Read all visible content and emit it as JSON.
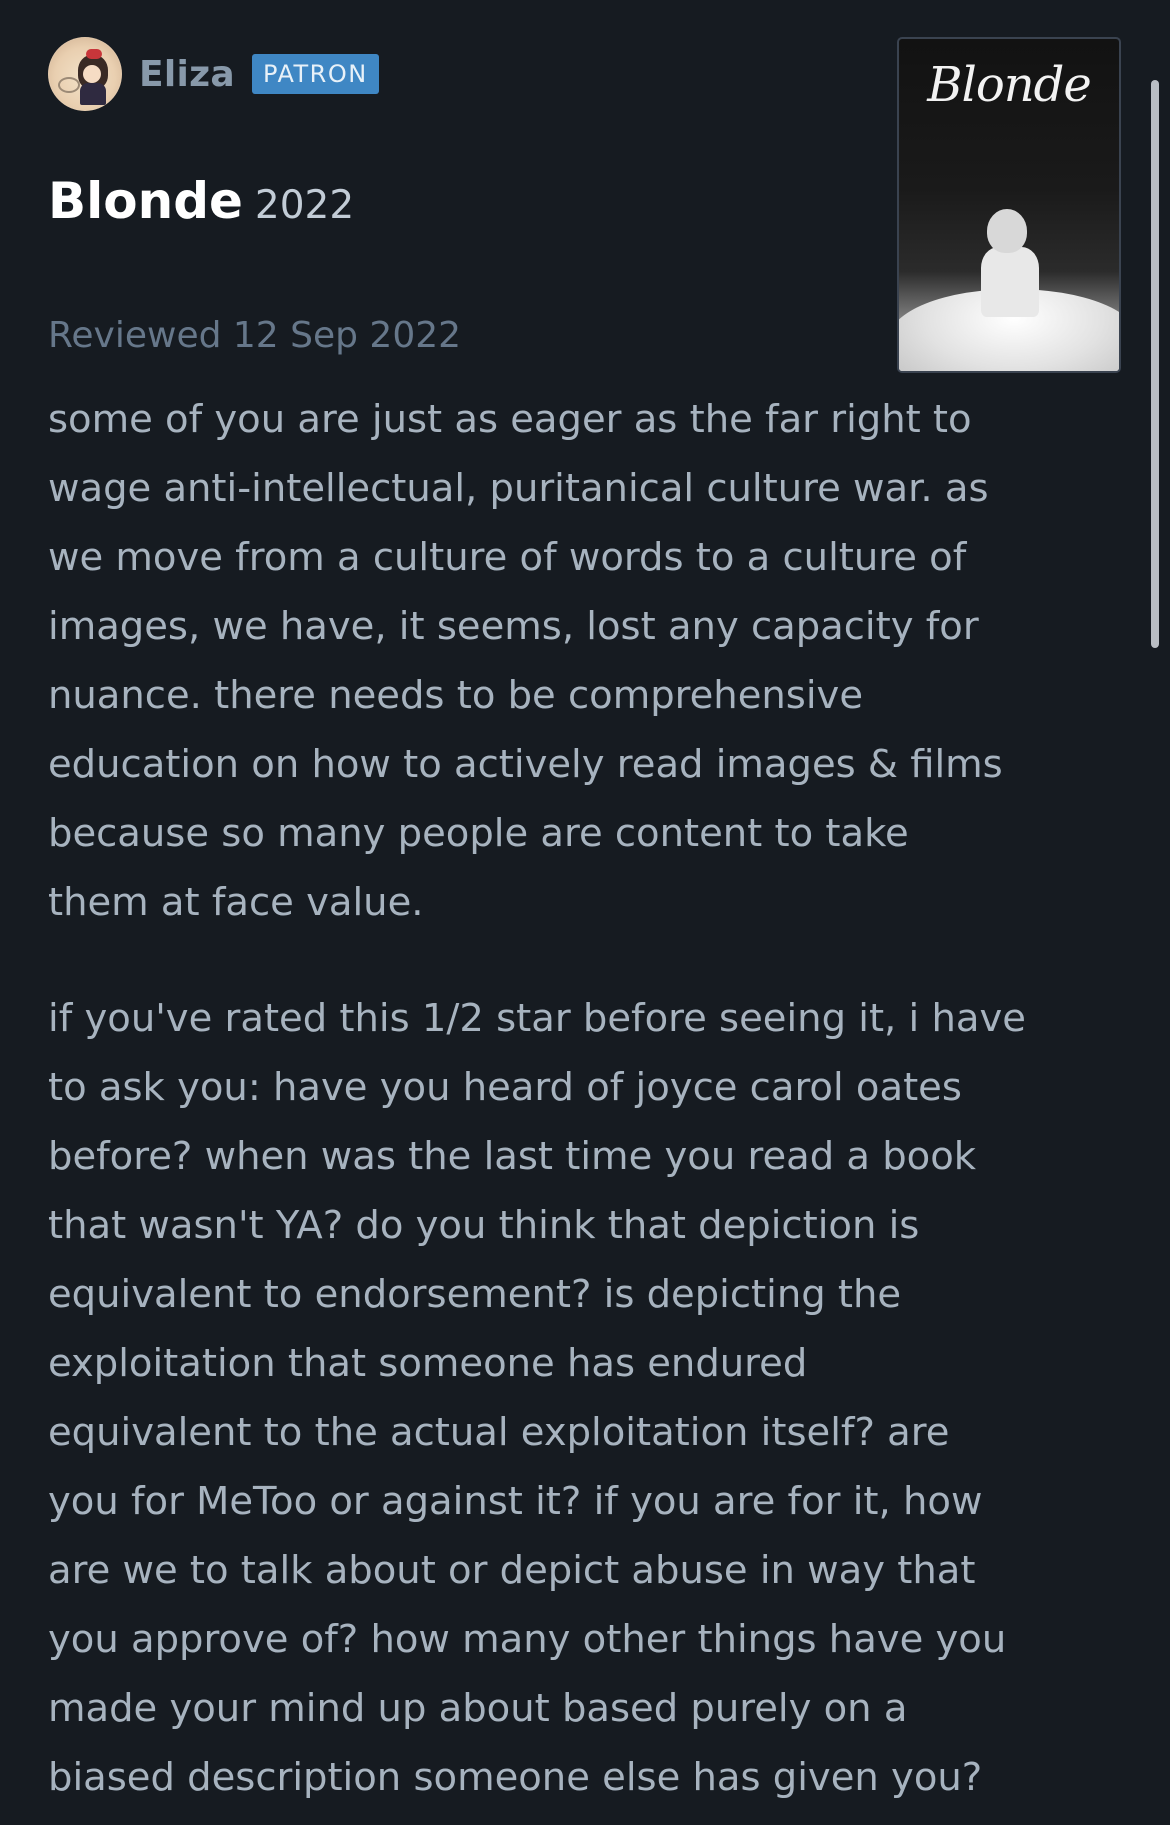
{
  "review": {
    "author": {
      "name": "Eliza",
      "badge": "PATRON",
      "avatar_icon": "avatar-illustration"
    },
    "film": {
      "title": "Blonde",
      "year": "2022",
      "poster_title": "Blonde"
    },
    "reviewed_date": "Reviewed 12 Sep 2022",
    "paragraphs": [
      "some of you are just as eager as the far right to\nwage anti-intellectual, puritanical culture war. as\nwe move from a culture of words to a culture of\nimages, we have, it seems, lost any capacity for\nnuance. there needs to be comprehensive\neducation on how to actively read images & films\nbecause so many people are content to take\nthem at face value.",
      "if you've rated this 1/2 star before seeing it, i have\nto ask you: have you heard of joyce carol oates\nbefore? when was the last time you read a book\nthat wasn't YA? do you think that depiction is\nequivalent to endorsement? is depicting the\nexploitation that someone has endured\nequivalent to the actual exploitation itself? are\nyou for MeToo or against it? if you are for it, how\nare we to talk about or depict abuse in way that\nyou approve of? how many other things have you\nmade your mind up about based purely on a\nbiased description someone else has given you?"
    ]
  },
  "colors": {
    "background": "#161b21",
    "badge": "#3f87c4",
    "body_text": "#a7b3bf",
    "muted_text": "#66778a"
  }
}
